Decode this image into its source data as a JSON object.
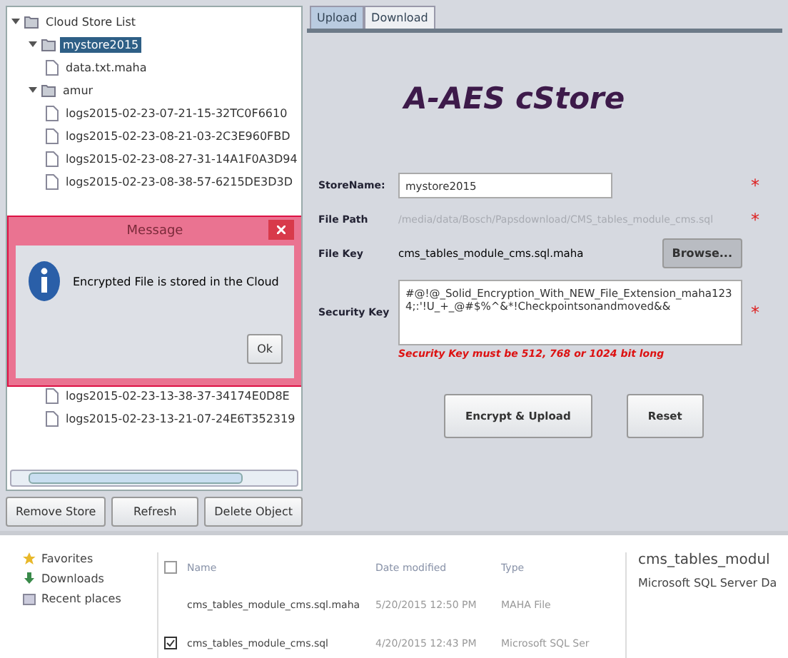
{
  "tree": {
    "label": "Cloud Store List",
    "expanded": true,
    "children": [
      {
        "label": "mystore2015",
        "selected": true,
        "expanded": true,
        "children": [
          {
            "label": "data.txt.maha",
            "selected": false
          }
        ]
      },
      {
        "label": "amur",
        "selected": false,
        "expanded": true,
        "children": [
          {
            "label": "logs2015-02-23-07-21-15-32TC0F6610",
            "selected": false
          },
          {
            "label": "logs2015-02-23-08-21-03-2C3E960FBD",
            "selected": false
          },
          {
            "label": "logs2015-02-23-08-27-31-14A1F0A3D94",
            "selected": false
          },
          {
            "label": "logs2015-02-23-08-38-57-6215DE3D3D",
            "selected": false
          },
          {
            "label": "logs2015-02-23-13-38-37-34174E0D8E",
            "selected": false
          },
          {
            "label": "logs2015-02-23-13-21-07-24E6T352319",
            "selected": false
          }
        ]
      }
    ]
  },
  "tree_buttons": [
    "Remove Store",
    "Refresh",
    "Delete Object"
  ],
  "dialog": {
    "title": "Message",
    "message": "Encrypted File is stored in the Cloud",
    "button": "Ok"
  },
  "tabs": [
    {
      "label": "Upload",
      "selected": true
    },
    {
      "label": "Download",
      "selected": false
    }
  ],
  "app_title": "A-AES cStore",
  "form": {
    "store_name": {
      "label": "StoreName:",
      "value": "mystore2015",
      "required": "*"
    },
    "file_path": {
      "label": "File Path",
      "value": "/media/data/Bosch/Papsdownload/CMS_tables_module_cms.sql",
      "required": "*"
    },
    "file_key": {
      "label": "File Key",
      "value": "cms_tables_module_cms.sql.maha",
      "button": "Browse..."
    },
    "security_key": {
      "label": "Security Key",
      "value": "#@!@_Solid_Encryption_With_NEW_File_Extension_maha1234;:'!U_+_@#$%^&*!Checkpointsonandmoved&&",
      "required": "*"
    },
    "hint": "Security Key must be 512, 768 or 1024 bit long"
  },
  "actions": [
    "Encrypt & Upload",
    "Reset"
  ],
  "explorer": {
    "nav": [
      "Favorites",
      "Downloads",
      "Recent places"
    ],
    "columns": [
      "Name",
      "Date modified",
      "Type"
    ],
    "all_checked": false,
    "rows": [
      {
        "name": "cms_tables_module_cms.sql.maha",
        "date": "5/20/2015 12:50 PM",
        "type": "MAHA File",
        "checked": false
      },
      {
        "name": "cms_tables_module_cms.sql",
        "date": "4/20/2015 12:43 PM",
        "type": "Microsoft SQL Ser",
        "checked": true
      }
    ],
    "preview_title": "cms_tables_modul",
    "preview_type": "Microsoft SQL Server Da"
  }
}
